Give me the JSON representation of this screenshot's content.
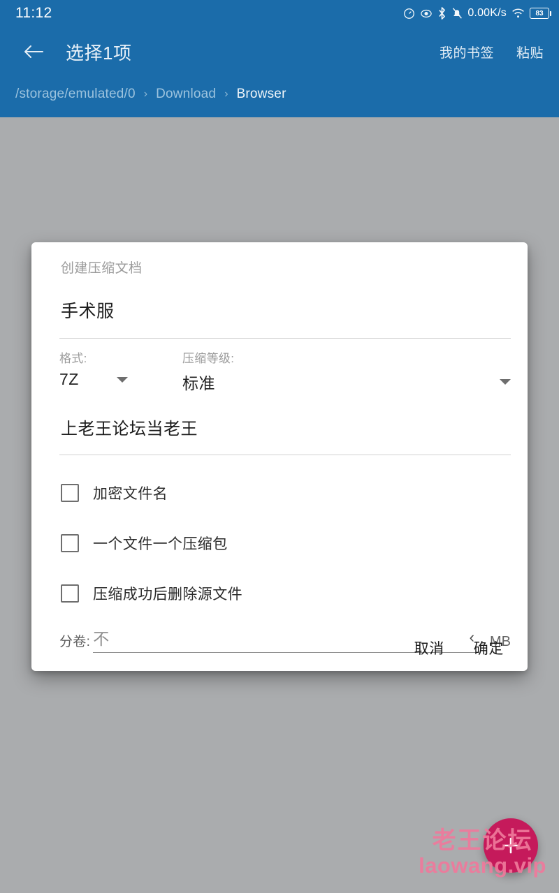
{
  "status_bar": {
    "clock": "11:12",
    "network_speed": "0.00K/s",
    "battery_level": "83",
    "icons": [
      "speed-meter-icon",
      "eye-protection-icon",
      "bluetooth-icon",
      "mute-bell-icon",
      "wifi-icon",
      "battery-icon"
    ]
  },
  "app_bar": {
    "back_icon": "back-arrow-icon",
    "title": "选择1项",
    "actions": [
      {
        "label": "我的书签",
        "name": "my-bookmarks-button"
      },
      {
        "label": "粘贴",
        "name": "paste-button"
      }
    ],
    "breadcrumb": [
      {
        "label": "/storage/emulated/0",
        "current": false
      },
      {
        "label": "Download",
        "current": false
      },
      {
        "label": "Browser",
        "current": true
      }
    ],
    "breadcrumb_separator": "›"
  },
  "dialog": {
    "title": "创建压缩文档",
    "archive_name": "手术服",
    "format": {
      "label": "格式:",
      "value": "7Z"
    },
    "level": {
      "label": "压缩等级:",
      "value": "标准"
    },
    "password": "上老王论坛当老王",
    "checkboxes": [
      {
        "label": "加密文件名",
        "checked": false,
        "name": "checkbox-encrypt-filenames"
      },
      {
        "label": "一个文件一个压缩包",
        "checked": false,
        "name": "checkbox-one-archive-per-file"
      },
      {
        "label": "压缩成功后删除源文件",
        "checked": false,
        "name": "checkbox-delete-source-after"
      }
    ],
    "split": {
      "label": "分卷:",
      "value": "不",
      "chevron": "‹",
      "unit": "MB"
    },
    "buttons": {
      "cancel": "取消",
      "confirm": "确定"
    }
  },
  "fab": {
    "icon": "plus-icon"
  },
  "watermark": {
    "line1": "老王论坛",
    "line2": "laowang.vip"
  },
  "colors": {
    "header_blue": "#1b6caa",
    "background_gray": "#aaacae",
    "fab_pink": "#c51a5b",
    "watermark_pink": "#ef7a9c"
  }
}
